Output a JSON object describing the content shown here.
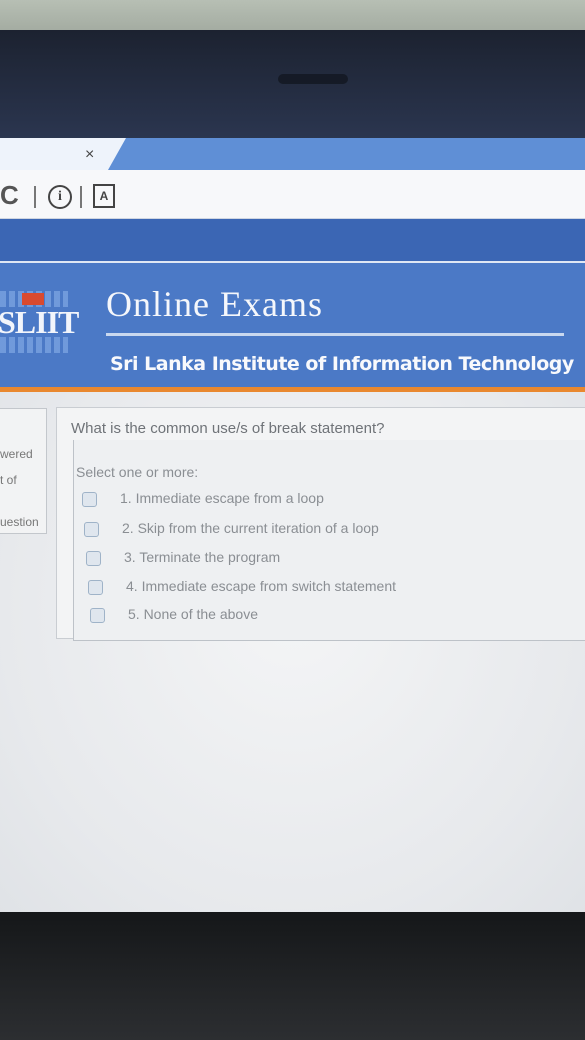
{
  "browser": {
    "tab_close_glyph": "×",
    "reload_glyph": "C",
    "info_glyph": "i",
    "page_icon_glyph": "A"
  },
  "banner": {
    "logo_text": "SLIIT",
    "title": "Online Exams",
    "subtitle": "Sri Lanka Institute of Information Technology",
    "colors": {
      "banner": "#4b79c6",
      "stripe": "#e9882f"
    }
  },
  "quiz_nav": {
    "line1": "wered",
    "line2": "t of",
    "line3": "uestion"
  },
  "question": {
    "text": "What is the common use/s of break statement?",
    "prompt": "Select one or more:",
    "options": [
      "1. Immediate escape from a loop",
      "2. Skip from the current iteration of a loop",
      "3. Terminate the program",
      "4. Immediate escape from switch statement",
      "5. None of the above"
    ]
  }
}
